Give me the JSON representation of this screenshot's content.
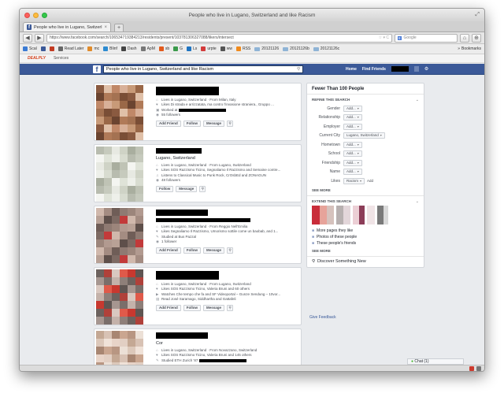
{
  "window": {
    "title": "People who live in Lugano, Switzerland and like Racism"
  },
  "tab": {
    "title": "People who live in Lugano, Switzerl",
    "favicon": "f",
    "close": "×",
    "new": "+"
  },
  "toolbar": {
    "back": "◀",
    "forward": "▶",
    "url": "https://www.facebook.com/search/106534719384213/residents/present/103781306327088/likers/intersect",
    "url_star": "☆ ▾ C",
    "search_engine": "8",
    "search_placeholder": "Google",
    "home": "⌂",
    "extra": "⊕"
  },
  "bookmarks": {
    "items": [
      {
        "label": "Scal",
        "color": "#3b7bd4"
      },
      {
        "label": "",
        "color": "#3b5998"
      },
      {
        "label": "",
        "color": "#c23b22"
      },
      {
        "label": "Read Later",
        "color": "#666666"
      },
      {
        "label": "mc",
        "color": "#e08b2b"
      },
      {
        "label": "Blinf",
        "color": "#2d8bd1"
      },
      {
        "label": "Dash",
        "color": "#444444"
      },
      {
        "label": "ApM",
        "color": "#777777"
      },
      {
        "label": "sb",
        "color": "#e25a1c"
      },
      {
        "label": "G",
        "color": "#3a9a4b"
      },
      {
        "label": "Ls",
        "color": "#1f74c1"
      },
      {
        "label": "urpte",
        "color": "#d33b3b"
      },
      {
        "label": "ww",
        "color": "#555555"
      },
      {
        "label": "RSS",
        "color": "#f08a1c"
      }
    ],
    "folders": [
      "20121126",
      "20121126b",
      "20121126c"
    ],
    "more": "»",
    "right_label": "Bookmarks"
  },
  "addons": {
    "deals": "DEALPLY",
    "services": "Services"
  },
  "facebook": {
    "logo": "f",
    "search_query": "People who live in Lugano, Switzerland and like Racism",
    "search_icon": "⚲",
    "nav": [
      "Home",
      "Find Friends"
    ],
    "settings": "⚙"
  },
  "results": [
    {
      "name_type": "redacted",
      "subline": "",
      "lines": [
        {
          "icon": "⌂",
          "text": "Lives in Lugano, Switzerland · From Milan, Italy"
        },
        {
          "icon": "♥",
          "text": "Likes Di strada e arrizzatata, ma contro l'invasione straniera., Gruppo ..."
        },
        {
          "icon": "▣",
          "text": "Worked at"
        },
        {
          "icon": "◉",
          "text": "55 followers"
        }
      ],
      "buttons": [
        "Add Friend",
        "Follow",
        "Message"
      ]
    },
    {
      "name_type": "partial",
      "subline": "Lugano, Switzerland",
      "lines": [
        {
          "icon": "⌂",
          "text": "Lives in Lugano, Switzerland · From Lugano, Switzerland"
        },
        {
          "icon": "♥",
          "text": "Likes SOS Razzismo Ticino, Segnaliamo Il Razzismo and Semaine contre..."
        },
        {
          "icon": "♫",
          "text": "Listens to Classical Music to Punk Rock, CrOsbEd and ZONAGUN"
        },
        {
          "icon": "◉",
          "text": "48 followers"
        }
      ],
      "buttons": [
        "Follow",
        "Message"
      ]
    },
    {
      "name_type": "partial2",
      "subline": "",
      "lines": [
        {
          "icon": "⌂",
          "text": "Lives in Lugano, Switzerland · From Reggio Nell'Emilia"
        },
        {
          "icon": "♥",
          "text": "Likes Segnaliamo Il Razzismo, Umorismo sottile come un baobab, and 1..."
        },
        {
          "icon": "✎",
          "text": "Studied at Bus Pazzal"
        },
        {
          "icon": "◉",
          "text": "1 follower"
        }
      ],
      "buttons": [
        "Add Friend",
        "Follow",
        "Message"
      ]
    },
    {
      "name_type": "redacted",
      "subline": "",
      "lines": [
        {
          "icon": "⌂",
          "text": "Lives in Lugano, Switzerland · From Lugano, Switzerland"
        },
        {
          "icon": "♥",
          "text": "Likes SOS Razzismo Ticino, Valeria Bruni and 60 others"
        },
        {
          "icon": "▶",
          "text": "Watches Che tempo che fa and SF Videoportal – Gunze Sendung – 10vor..."
        },
        {
          "icon": "▤",
          "text": "Read José Saramago, Siddhartha and Gattafeli"
        }
      ],
      "buttons": [
        "Add Friend",
        "Follow",
        "Message"
      ]
    },
    {
      "name_type": "partial3",
      "subline": "Cor",
      "lines": [
        {
          "icon": "⌂",
          "text": "Lives in Lugano, Switzerland · From Novazzano, Switzerland"
        },
        {
          "icon": "♥",
          "text": "Likes SOS Razzismo Ticino, Valeria Bruni and 145 others"
        },
        {
          "icon": "✎",
          "text": "Studied ETH Zurich '87"
        }
      ],
      "buttons": []
    }
  ],
  "sidebar": {
    "header": "Fewer Than 100 People",
    "refine_title": "REFINE THIS SEARCH",
    "filters": [
      {
        "label": "Gender",
        "value": "Add...",
        "extra": ""
      },
      {
        "label": "Relationship",
        "value": "Add...",
        "extra": ""
      },
      {
        "label": "Employer",
        "value": "Add...",
        "extra": ""
      },
      {
        "label": "Current City",
        "value": "Lugano, Switzerland",
        "extra": ""
      },
      {
        "label": "Hometown",
        "value": "Add...",
        "extra": ""
      },
      {
        "label": "School",
        "value": "Add...",
        "extra": ""
      },
      {
        "label": "Friendship",
        "value": "Add...",
        "extra": ""
      },
      {
        "label": "Name",
        "value": "Add...",
        "extra": ""
      },
      {
        "label": "Likes",
        "value": "Racism",
        "extra": "Add"
      }
    ],
    "see_more": "SEE MORE",
    "extend_title": "EXTEND THIS SEARCH",
    "extend_links": [
      "More pages they like",
      "Photos of these people",
      "These people's friends"
    ],
    "see_more_2": "SEE MORE",
    "discover": "Discover Something New",
    "give_feedback": "Give Feedback"
  },
  "chat": {
    "label": "Chat (1)"
  },
  "colors": {
    "facebook_blue": "#3b5998",
    "page_bg": "#e9ebee"
  }
}
